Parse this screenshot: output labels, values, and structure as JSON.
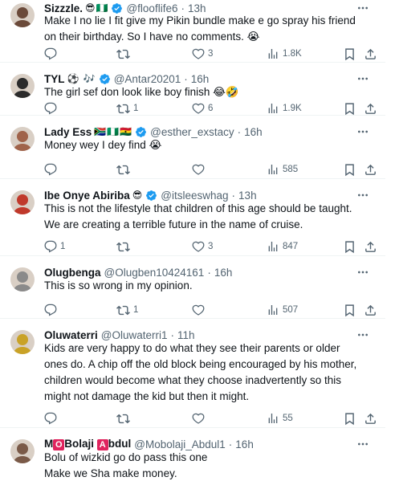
{
  "tweets": [
    {
      "name": "Sizzzle.",
      "name_emoji": "😎🇳🇬",
      "verified": true,
      "handle": "@flooflife6",
      "time": "13h",
      "text": "Make I no lie I fit give my Pikin bundle make e go spray his friend on their birthday. So I have no comments. 😭",
      "replies": "",
      "retweets": "",
      "likes": "3",
      "views": "1.8K",
      "avatar_color": "#6b4a3a"
    },
    {
      "name": "TYL",
      "name_emoji": "⚽ 🎶",
      "verified": true,
      "handle": "@Antar20201",
      "time": "16h",
      "text": "The girl sef don look like boy finish 😂🤣",
      "replies": "",
      "retweets": "1",
      "likes": "6",
      "views": "1.9K",
      "avatar_color": "#2b2b2b"
    },
    {
      "name": "Lady Ess",
      "name_emoji": "🇿🇦🇳🇬🇬🇭",
      "verified": true,
      "handle": "@esther_exstacy",
      "time": "16h",
      "text": "Money wey I dey find 😭",
      "replies": "",
      "retweets": "",
      "likes": "",
      "views": "585",
      "avatar_color": "#a0634a"
    },
    {
      "name": "Ibe Onye Abiriba",
      "name_emoji": "😎",
      "verified": true,
      "handle": "@itsleeswhag",
      "time": "13h",
      "text": "This is not the lifestyle that children of this age should be taught. We are creating a terrible future in the name of cruise.",
      "replies": "1",
      "retweets": "",
      "likes": "3",
      "views": "847",
      "avatar_color": "#c0392b"
    },
    {
      "name": "Olugbenga",
      "name_emoji": "",
      "verified": false,
      "handle": "@Olugben10424161",
      "time": "16h",
      "text": "This is so wrong in my opinion.",
      "replies": "",
      "retweets": "1",
      "likes": "",
      "views": "507",
      "avatar_color": "#8a8a8a"
    },
    {
      "name": "Oluwaterri",
      "name_emoji": "",
      "verified": false,
      "handle": "@Oluwaterri1",
      "time": "11h",
      "text": "Kids are very happy to do what they see their parents or older ones do. A chip off the old block being encouraged by his mother, children would become what they choose inadvertently so this might not damage the kid but then it might.",
      "replies": "",
      "retweets": "",
      "likes": "",
      "views": "55",
      "avatar_color": "#c9a227"
    },
    {
      "name_parts": [
        "M",
        "O",
        "Bolaji ",
        "A",
        "bdul"
      ],
      "verified": false,
      "handle": "@Mobolaji_Abdul1",
      "time": "16h",
      "text_lines": [
        "Bolu of wizkid go do pass this one",
        "Make we Sha make money."
      ],
      "avatar_color": "#7a5a48"
    }
  ]
}
